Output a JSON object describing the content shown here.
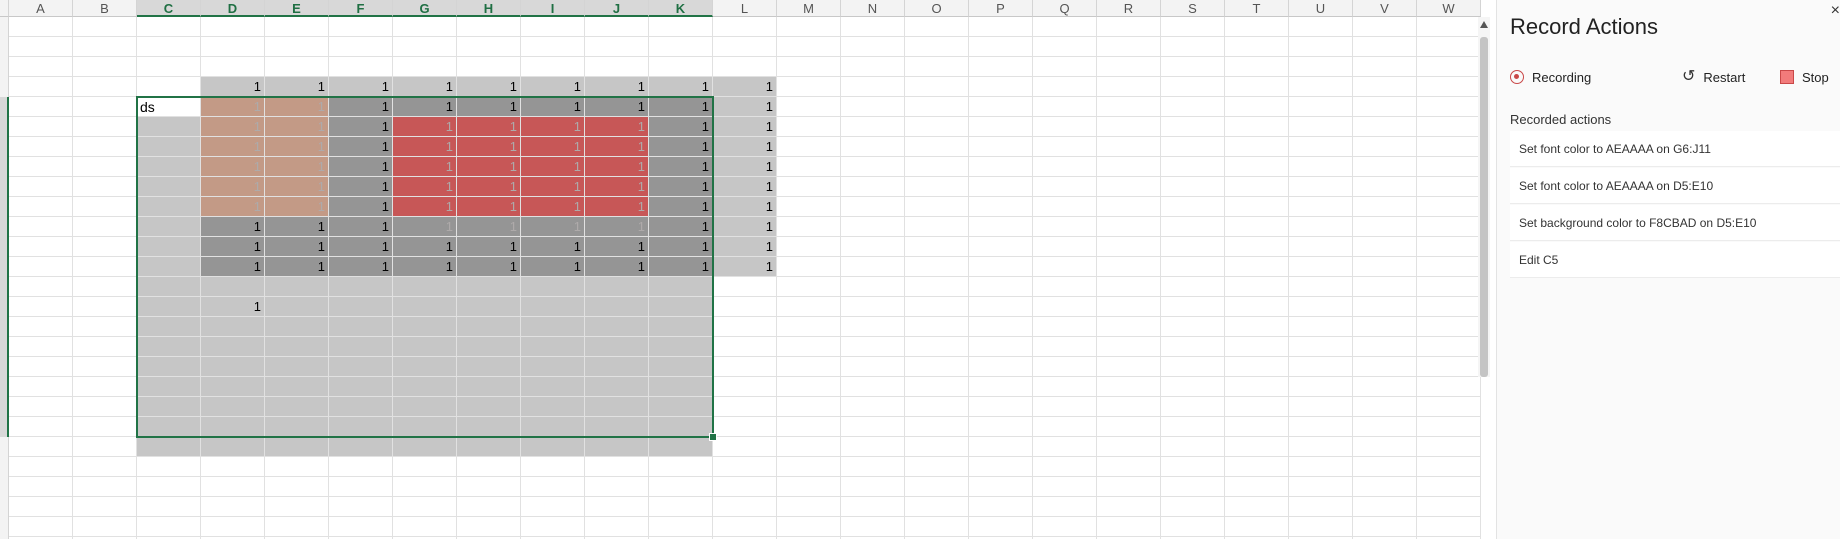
{
  "sheet": {
    "columns": [
      "A",
      "B",
      "C",
      "D",
      "E",
      "F",
      "G",
      "H",
      "I",
      "J",
      "K",
      "L",
      "M",
      "N",
      "O",
      "P",
      "Q",
      "R",
      "S",
      "T",
      "U",
      "V",
      "W"
    ],
    "selected_columns": [
      "C",
      "D",
      "E",
      "F",
      "G",
      "H",
      "I",
      "J",
      "K"
    ],
    "cell_text": {
      "C5": "ds"
    },
    "cell_value": "1",
    "colors": {
      "outer_gray": "#c6c6c6",
      "dark_gray": "#959595",
      "tan": "#c39a86",
      "red": "#c75757",
      "faded_font": "#aeaaaa",
      "selection": "#217346"
    }
  },
  "panel": {
    "title": "Record Actions",
    "close": "×",
    "recording_label": "Recording",
    "restart_label": "Restart",
    "stop_label": "Stop",
    "recorded_actions_label": "Recorded actions",
    "actions": [
      "Set font color to AEAAAA on G6:J11",
      "Set font color to AEAAAA on D5:E10",
      "Set background color to F8CBAD on D5:E10",
      "Edit C5"
    ]
  }
}
